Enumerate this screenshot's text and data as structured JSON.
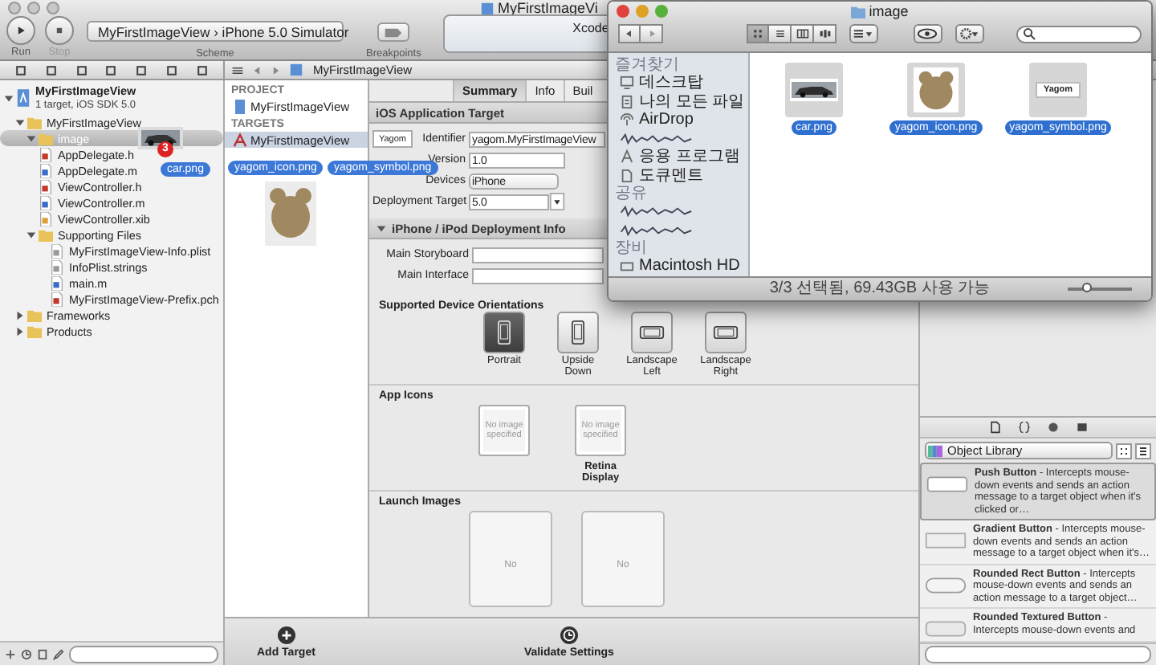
{
  "xcode": {
    "title": "MyFirstImageVi",
    "toolbar": {
      "run": "Run",
      "stop": "Stop",
      "scheme_target": "MyFirstImageView",
      "scheme_separator": "›",
      "scheme_device": "iPhone 5.0 Simulator",
      "scheme_label": "Scheme",
      "breakpoints": "Breakpoints",
      "activity": "Xcode"
    },
    "navigator": {
      "tree": [
        {
          "label": "MyFirstImageView",
          "subtitle": "1 target, iOS SDK 5.0",
          "kind": "project",
          "expanded": true,
          "selected": false,
          "children": [
            {
              "label": "MyFirstImageView",
              "kind": "folder",
              "expanded": true,
              "selected": false,
              "children": [
                {
                  "label": "image",
                  "kind": "folder",
                  "expanded": true,
                  "selected": true
                },
                {
                  "label": "AppDelegate.h",
                  "kind": "h",
                  "selected": false
                },
                {
                  "label": "AppDelegate.m",
                  "kind": "m",
                  "selected": false
                },
                {
                  "label": "ViewController.h",
                  "kind": "h",
                  "selected": false
                },
                {
                  "label": "ViewController.m",
                  "kind": "m",
                  "selected": false
                },
                {
                  "label": "ViewController.xib",
                  "kind": "xib",
                  "selected": false
                },
                {
                  "label": "Supporting Files",
                  "kind": "folder",
                  "expanded": true,
                  "selected": false,
                  "children": [
                    {
                      "label": "MyFirstImageView-Info.plist",
                      "kind": "plist",
                      "selected": false
                    },
                    {
                      "label": "InfoPlist.strings",
                      "kind": "strings",
                      "selected": false
                    },
                    {
                      "label": "main.m",
                      "kind": "m",
                      "selected": false
                    },
                    {
                      "label": "MyFirstImageView-Prefix.pch",
                      "kind": "pch",
                      "selected": false
                    }
                  ]
                }
              ]
            },
            {
              "label": "Frameworks",
              "kind": "folder",
              "expanded": false,
              "selected": false
            },
            {
              "label": "Products",
              "kind": "folder",
              "expanded": false,
              "selected": false
            }
          ]
        }
      ]
    },
    "jump_bar": "MyFirstImageView",
    "project_list": {
      "project_header": "PROJECT",
      "project": "MyFirstImageView",
      "targets_header": "TARGETS",
      "target": "MyFirstImageView",
      "target_selected": true
    },
    "tabs": [
      {
        "label": "Summary",
        "selected": true
      },
      {
        "label": "Info",
        "selected": false
      },
      {
        "label": "Buil",
        "selected": false
      }
    ],
    "ios_target": {
      "header": "iOS Application Target",
      "symbol": "Yagom",
      "fields": [
        {
          "label": "Identifier",
          "value": "yagom.MyFirstImageView",
          "kind": "text"
        },
        {
          "label": "Version",
          "value": "1.0",
          "kind": "text"
        },
        {
          "label": "Devices",
          "value": "iPhone",
          "kind": "select"
        },
        {
          "label": "Deployment Target",
          "value": "5.0",
          "kind": "combo"
        }
      ]
    },
    "deployment": {
      "header": "iPhone / iPod Deployment Info",
      "expanded": true,
      "fields": [
        {
          "label": "Main Storyboard"
        },
        {
          "label": "Main Interface"
        }
      ]
    },
    "orientations": {
      "title": "Supported Device Orientations",
      "items": [
        {
          "label": "Portrait",
          "kind": "portrait",
          "selected": true
        },
        {
          "label": "Upside Down",
          "kind": "portrait",
          "selected": false
        },
        {
          "label": "Landscape Left",
          "kind": "landscape",
          "selected": false
        },
        {
          "label": "Landscape Right",
          "kind": "landscape",
          "selected": false
        }
      ]
    },
    "app_icons": {
      "title": "App Icons",
      "wells": [
        {
          "text": "No image specified"
        },
        {
          "text": "No image specified",
          "caption": "Retina Display"
        }
      ]
    },
    "launch_images": {
      "title": "Launch Images",
      "wells": [
        {
          "text": "No"
        },
        {
          "text": "No"
        }
      ]
    },
    "bottom_bar": [
      {
        "label": "Add Target",
        "kind": "add"
      },
      {
        "label": "Validate Settings",
        "kind": "validate"
      }
    ],
    "library": {
      "selector": "Object Library",
      "items": [
        {
          "text": "**Push Button** - Intercepts mouse-down events and sends an action message to a target object when it's clicked or…",
          "kind": "push",
          "selected": true
        },
        {
          "text": "**Gradient Button** - Intercepts mouse-down events and sends an action message to a target object when it's…",
          "kind": "gradient",
          "selected": false
        },
        {
          "text": "**Rounded Rect Button** - Intercepts mouse-down events and sends an action message to a target object…",
          "kind": "rounded",
          "selected": false
        },
        {
          "text": "**Rounded Textured Button** - Intercepts mouse-down events and",
          "kind": "textured",
          "selected": false
        }
      ]
    }
  },
  "finder": {
    "title": "image",
    "views": [
      {
        "kind": "icon",
        "selected": true
      },
      {
        "kind": "list",
        "selected": false
      },
      {
        "kind": "column",
        "selected": false
      },
      {
        "kind": "flow",
        "selected": false
      }
    ],
    "sidebar": [
      {
        "title": "즐겨찾기",
        "items": [
          {
            "kind": "desktop",
            "label": "데스크탑"
          },
          {
            "kind": "all_files",
            "label": "나의 모든 파일"
          },
          {
            "kind": "airdrop",
            "label": "AirDrop"
          },
          {
            "kind": "redacted"
          },
          {
            "kind": "apps",
            "label": "응용 프로그램"
          },
          {
            "kind": "documents",
            "label": "도큐멘트"
          }
        ]
      },
      {
        "title": "공유",
        "items": [
          {
            "kind": "redacted"
          },
          {
            "kind": "redacted"
          }
        ]
      },
      {
        "title": "장비",
        "items": [
          {
            "kind": "hd",
            "label": "Macintosh HD"
          }
        ]
      }
    ],
    "files": [
      {
        "name": "car.png",
        "kind": "car",
        "selected": true
      },
      {
        "name": "yagom_icon.png",
        "kind": "bear",
        "selected": true
      },
      {
        "name": "yagom_symbol.png",
        "kind": "symbol",
        "symbol_text": "Yagom",
        "selected": true
      }
    ],
    "status": "3/3 선택됨, 69.43GB 사용 가능",
    "zoom": {
      "level": 0.25
    }
  },
  "drag": {
    "count": "3",
    "labels": [
      "car.png",
      "yagom_icon.png",
      "yagom_symbol.png"
    ]
  }
}
